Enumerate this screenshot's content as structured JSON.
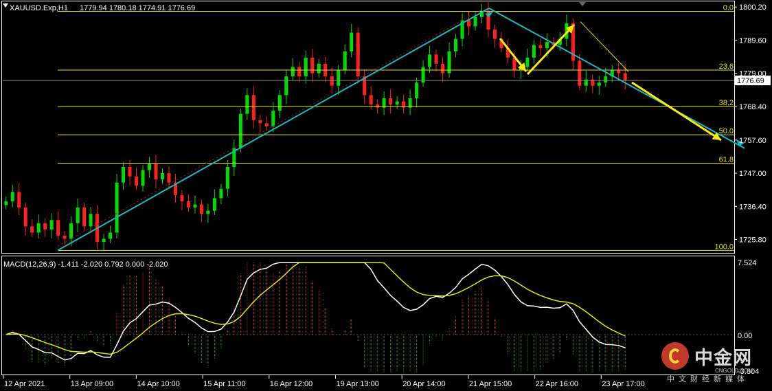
{
  "header": {
    "symbol": "XAUUSD.Exp,H1",
    "ohlc": "1779.94 1780.18 1774.91 1776.69"
  },
  "macd": {
    "label": "MACD(12,26,9) -1.411 -2.020 0.792 0.000 -2.020",
    "axis_top": "7.524",
    "axis_zero": "0.00",
    "axis_bottom": "-3.804",
    "range": [
      -3.804,
      7.524
    ]
  },
  "chart_data": {
    "type": "candlestick",
    "ylim": [
      1721.5,
      1802.0
    ],
    "price_ticks": [
      "1800.20",
      "1789.60",
      "1779.00",
      "1768.40",
      "1757.60",
      "1747.00",
      "1736.40",
      "1725.80"
    ],
    "current_price": "1776.69",
    "x_ticks": [
      "12 Apr 2021",
      "13 Apr 09:00",
      "14 Apr 10:00",
      "15 Apr 11:00",
      "16 Apr 12:00",
      "19 Apr 13:00",
      "20 Apr 14:00",
      "21 Apr 15:00",
      "22 Apr 16:00",
      "23 Apr 17:00"
    ],
    "fibonacci": [
      {
        "level": "0.0",
        "price": 1798.8
      },
      {
        "level": "23.6",
        "price": 1780.0
      },
      {
        "level": "38.2",
        "price": 1768.4
      },
      {
        "level": "50.0",
        "price": 1759.3
      },
      {
        "level": "61.8",
        "price": 1750.2
      },
      {
        "level": "100.0",
        "price": 1722.3
      }
    ],
    "close_series": [
      1738,
      1741,
      1736,
      1730,
      1728,
      1731,
      1729,
      1732,
      1727,
      1726,
      1731,
      1736,
      1730,
      1734,
      1725,
      1726,
      1728,
      1744,
      1749,
      1746,
      1743,
      1748,
      1750,
      1745,
      1747,
      1744,
      1740,
      1738,
      1736,
      1737,
      1734,
      1735,
      1739,
      1742,
      1749,
      1755,
      1766,
      1772,
      1764,
      1763,
      1762,
      1767,
      1772,
      1778,
      1781,
      1778,
      1784,
      1779,
      1782,
      1778,
      1775,
      1780,
      1786,
      1792,
      1778,
      1772,
      1769,
      1768,
      1771,
      1769,
      1770,
      1768,
      1771,
      1776,
      1781,
      1785,
      1782,
      1779,
      1786,
      1790,
      1796,
      1794,
      1797,
      1799,
      1793,
      1790,
      1787,
      1784,
      1780,
      1781,
      1784,
      1788,
      1787,
      1789,
      1788,
      1790,
      1795,
      1783,
      1775,
      1777,
      1775,
      1776,
      1778,
      1780,
      1779,
      1776.69
    ]
  },
  "watermark": {
    "name": "中金网",
    "url": "CNGOLD.COM",
    "subtitle": "中文财经新媒体"
  }
}
